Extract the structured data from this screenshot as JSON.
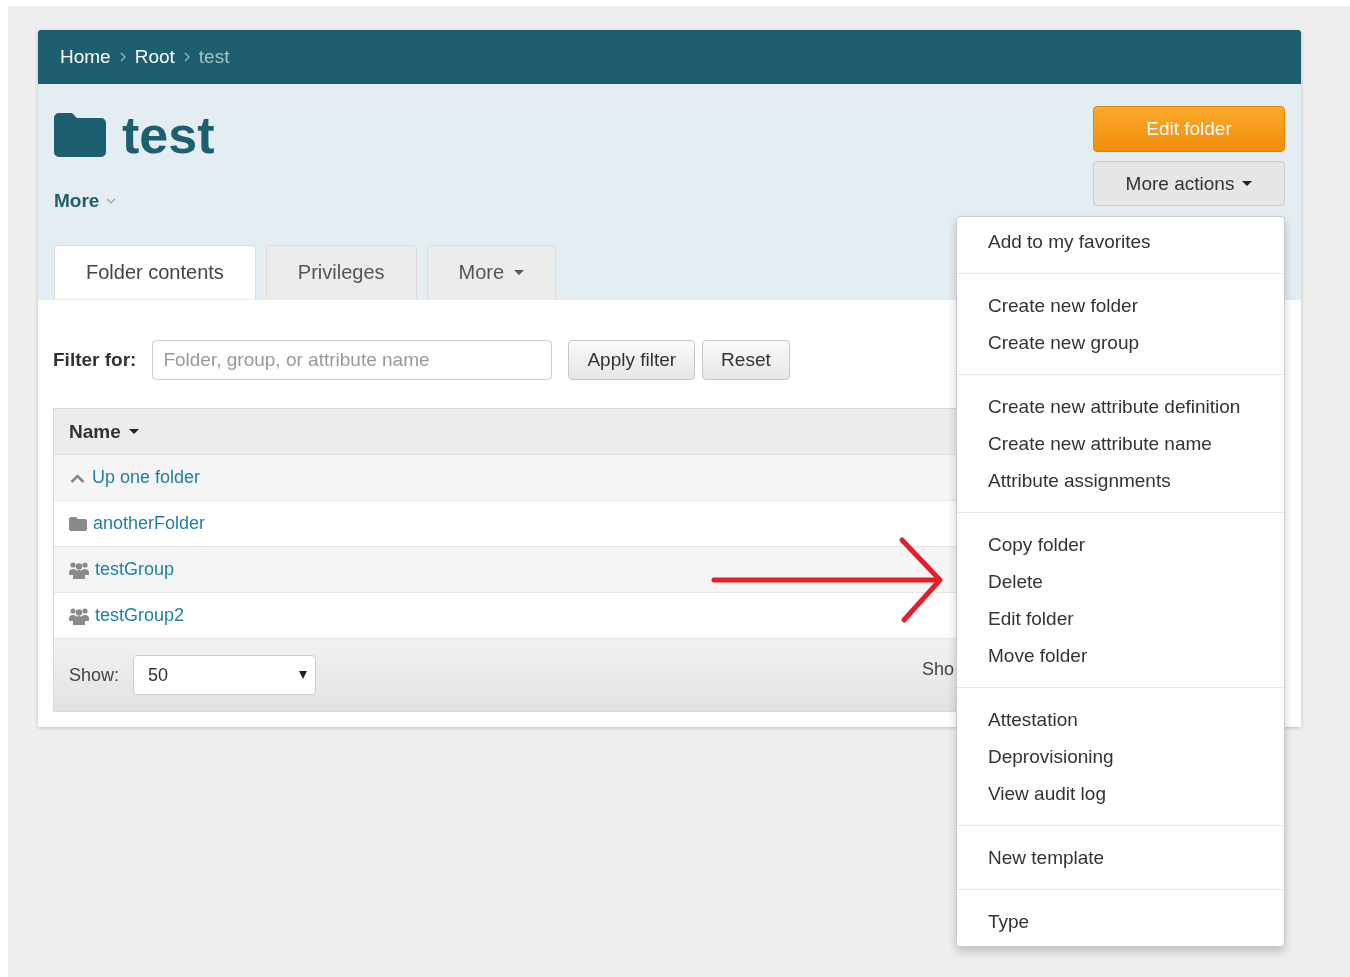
{
  "breadcrumb": [
    {
      "label": "Home",
      "current": false
    },
    {
      "label": "Root",
      "current": false
    },
    {
      "label": "test",
      "current": true
    }
  ],
  "folder": {
    "title": "test",
    "more_label": "More"
  },
  "actions": {
    "primary": "Edit folder",
    "more": "More actions"
  },
  "tabs": [
    {
      "label": "Folder contents",
      "selected": true,
      "caret": false
    },
    {
      "label": "Privileges",
      "selected": false,
      "caret": false
    },
    {
      "label": "More",
      "selected": false,
      "caret": true
    }
  ],
  "filter": {
    "label": "Filter for:",
    "placeholder": "Folder, group, or attribute name",
    "apply": "Apply filter",
    "reset": "Reset"
  },
  "table": {
    "column": "Name",
    "rows": [
      {
        "kind": "up",
        "name": "Up one folder"
      },
      {
        "kind": "folder",
        "name": "anotherFolder"
      },
      {
        "kind": "group",
        "name": "testGroup"
      },
      {
        "kind": "group",
        "name": "testGroup2"
      }
    ]
  },
  "footer": {
    "show_label": "Show:",
    "page_size": "50",
    "status": "Sho"
  },
  "more_actions_menu": {
    "groups": [
      [
        "Add to my favorites"
      ],
      [
        "Create new folder",
        "Create new group"
      ],
      [
        "Create new attribute definition",
        "Create new attribute name",
        "Attribute assignments"
      ],
      [
        "Copy folder",
        "Delete",
        "Edit folder",
        "Move folder"
      ],
      [
        "Attestation",
        "Deprovisioning",
        "View audit log"
      ],
      [
        "New template"
      ],
      [
        "Type"
      ]
    ]
  }
}
